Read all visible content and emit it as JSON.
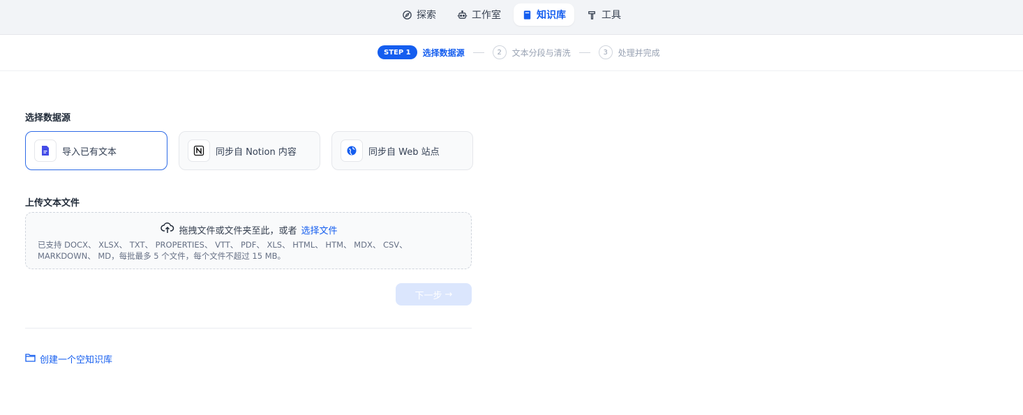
{
  "nav": {
    "items": [
      {
        "label": "探索",
        "icon": "compass-icon",
        "active": false
      },
      {
        "label": "工作室",
        "icon": "robot-icon",
        "active": false
      },
      {
        "label": "知识库",
        "icon": "book-icon",
        "active": true
      },
      {
        "label": "工具",
        "icon": "hammer-icon",
        "active": false
      }
    ]
  },
  "stepper": {
    "step1_badge": "STEP 1",
    "step1_label": "选择数据源",
    "step2_num": "2",
    "step2_label": "文本分段与清洗",
    "step3_num": "3",
    "step3_label": "处理并完成"
  },
  "datasource": {
    "title": "选择数据源",
    "options": [
      {
        "label": "导入已有文本",
        "icon": "document-icon",
        "selected": true
      },
      {
        "label": "同步自 Notion 内容",
        "icon": "notion-icon",
        "selected": false
      },
      {
        "label": "同步自 Web 站点",
        "icon": "globe-icon",
        "selected": false
      }
    ]
  },
  "upload": {
    "title": "上传文本文件",
    "drag_text": "拖拽文件或文件夹至此，或者",
    "select_link": "选择文件",
    "tip": "已支持 DOCX、 XLSX、 TXT、 PROPERTIES、 VTT、 PDF、 XLS、 HTML、 HTM、 MDX、 CSV、 MARKDOWN、 MD，每批最多 5 个文件，每个文件不超过 15 MB。"
  },
  "next_button": {
    "label": "下一步",
    "arrow": "→"
  },
  "create_empty": {
    "label": "创建一个空知识库"
  },
  "colors": {
    "accent": "#155eef",
    "disabled_button": "#dbe6fd"
  }
}
